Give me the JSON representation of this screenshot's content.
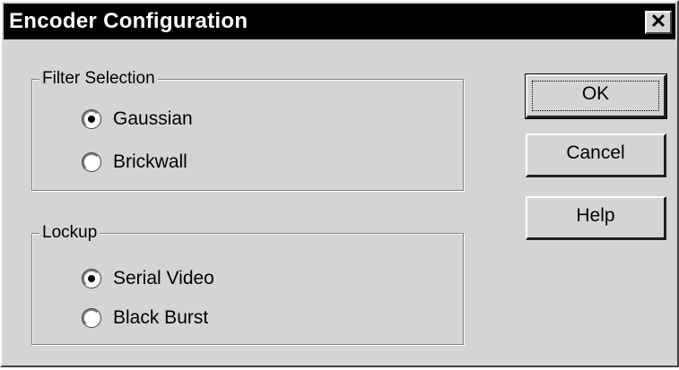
{
  "window": {
    "title": "Encoder Configuration",
    "close_glyph": "✕"
  },
  "filter_selection": {
    "legend": "Filter Selection",
    "options": [
      {
        "label": "Gaussian",
        "selected": true
      },
      {
        "label": "Brickwall",
        "selected": false
      }
    ]
  },
  "lockup": {
    "legend": "Lockup",
    "options": [
      {
        "label": "Serial Video",
        "selected": true
      },
      {
        "label": "Black Burst",
        "selected": false
      }
    ]
  },
  "buttons": {
    "ok": "OK",
    "cancel": "Cancel",
    "help": "Help"
  }
}
